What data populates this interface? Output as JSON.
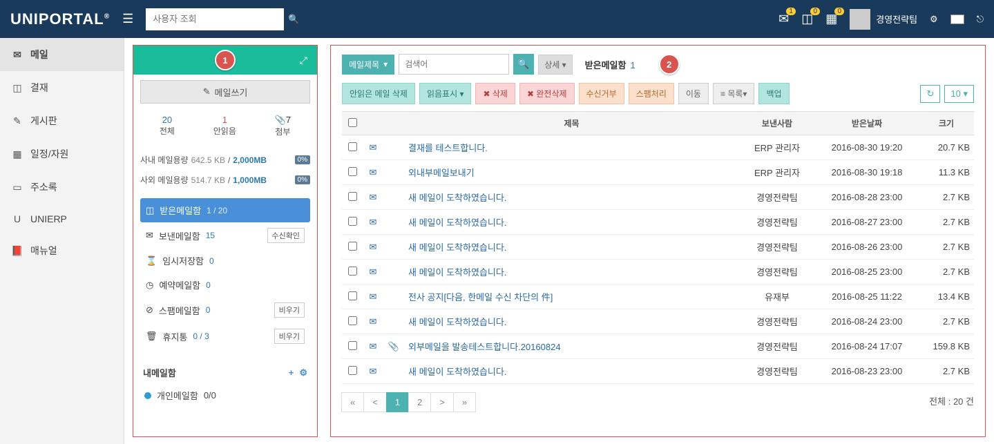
{
  "header": {
    "logo": "UNIPORTAL",
    "search_placeholder": "사용자 조회",
    "username": "경영전략팀",
    "badges": {
      "mail": "1",
      "approval": "0",
      "schedule": "0"
    }
  },
  "leftnav": [
    {
      "icon": "✉",
      "label": "메일"
    },
    {
      "icon": "◫",
      "label": "결재"
    },
    {
      "icon": "✎",
      "label": "게시판"
    },
    {
      "icon": "▦",
      "label": "일정/자원"
    },
    {
      "icon": "▭",
      "label": "주소록"
    },
    {
      "icon": "U",
      "label": "UNIERP"
    },
    {
      "icon": "📕",
      "label": "매뉴얼"
    }
  ],
  "marker1": "1",
  "marker2": "2",
  "compose": "메일쓰기",
  "stats": {
    "total_n": "20",
    "total_l": "전체",
    "unread_n": "1",
    "unread_l": "안읽음",
    "attach_n": "7",
    "attach_l": "첨부",
    "attach_icon": "📎"
  },
  "quota": [
    {
      "label": "사내 메일용량",
      "used": "642.5 KB",
      "max": "2,000MB",
      "pct": "0%"
    },
    {
      "label": "사외 메일용량",
      "used": "514.7 KB",
      "max": "1,000MB",
      "pct": "0%"
    }
  ],
  "folders": [
    {
      "icon": "◫",
      "name": "받은메일함",
      "count": "1 / 20",
      "active": true
    },
    {
      "icon": "✉",
      "name": "보낸메일함",
      "count": "15",
      "btn": "수신확인"
    },
    {
      "icon": "⌛",
      "name": "임시저장함",
      "count": "0"
    },
    {
      "icon": "◷",
      "name": "예약메일함",
      "count": "0"
    },
    {
      "icon": "⊘",
      "name": "스팸메일함",
      "count": "0",
      "btn": "비우기"
    },
    {
      "icon": "🗑",
      "name": "휴지통",
      "count": "0 / 3",
      "btn": "비우기"
    }
  ],
  "myfolder_title": "내메일함",
  "myfolders": [
    {
      "name": "개인메일함",
      "count": "0/0"
    }
  ],
  "searchbar": {
    "type": "메일제목",
    "placeholder": "검색어",
    "detail": "상세",
    "folder": "받은메일함",
    "folder_n": "1"
  },
  "actions": {
    "del_unread": "안읽은 메일 삭제",
    "mark_read": "읽음표시",
    "delete": "삭제",
    "del_perm": "완전삭제",
    "reject": "수신거부",
    "spam": "스팸처리",
    "move": "이동",
    "list": "목록",
    "backup": "백업",
    "pagesize": "10"
  },
  "columns": {
    "subject": "제목",
    "sender": "보낸사람",
    "date": "받은날짜",
    "size": "크기"
  },
  "rows": [
    {
      "unread": true,
      "attach": false,
      "subject": "결재를 테스트합니다.",
      "sender": "ERP 관리자",
      "date": "2016-08-30 19:20",
      "size": "20.7 KB"
    },
    {
      "unread": false,
      "attach": false,
      "subject": "외내부메일보내기",
      "sender": "ERP 관리자",
      "date": "2016-08-30 19:18",
      "size": "11.3 KB"
    },
    {
      "unread": false,
      "attach": false,
      "subject": "새 메일이 도착하였습니다.",
      "sender": "경영전략팀",
      "date": "2016-08-28 23:00",
      "size": "2.7 KB"
    },
    {
      "unread": false,
      "attach": false,
      "subject": "새 메일이 도착하였습니다.",
      "sender": "경영전략팀",
      "date": "2016-08-27 23:00",
      "size": "2.7 KB"
    },
    {
      "unread": false,
      "attach": false,
      "subject": "새 메일이 도착하였습니다.",
      "sender": "경영전략팀",
      "date": "2016-08-26 23:00",
      "size": "2.7 KB"
    },
    {
      "unread": false,
      "attach": false,
      "subject": "새 메일이 도착하였습니다.",
      "sender": "경영전략팀",
      "date": "2016-08-25 23:00",
      "size": "2.7 KB"
    },
    {
      "unread": false,
      "attach": false,
      "subject": "전사 공지[다음, 한메일 수신 차단의 件]",
      "sender": "유재부",
      "date": "2016-08-25 11:22",
      "size": "13.4 KB"
    },
    {
      "unread": false,
      "attach": false,
      "subject": "새 메일이 도착하였습니다.",
      "sender": "경영전략팀",
      "date": "2016-08-24 23:00",
      "size": "2.7 KB"
    },
    {
      "unread": false,
      "attach": true,
      "subject": "외부메일을 발송테스트합니다.20160824",
      "sender": "경영전략팀",
      "date": "2016-08-24 17:07",
      "size": "159.8 KB"
    },
    {
      "unread": false,
      "attach": false,
      "subject": "새 메일이 도착하였습니다.",
      "sender": "경영전략팀",
      "date": "2016-08-23 23:00",
      "size": "2.7 KB"
    }
  ],
  "pager": [
    "«",
    "<",
    "1",
    "2",
    ">",
    "»"
  ],
  "pager_active": "1",
  "total_label": "전체 :",
  "total_count": "20 건"
}
